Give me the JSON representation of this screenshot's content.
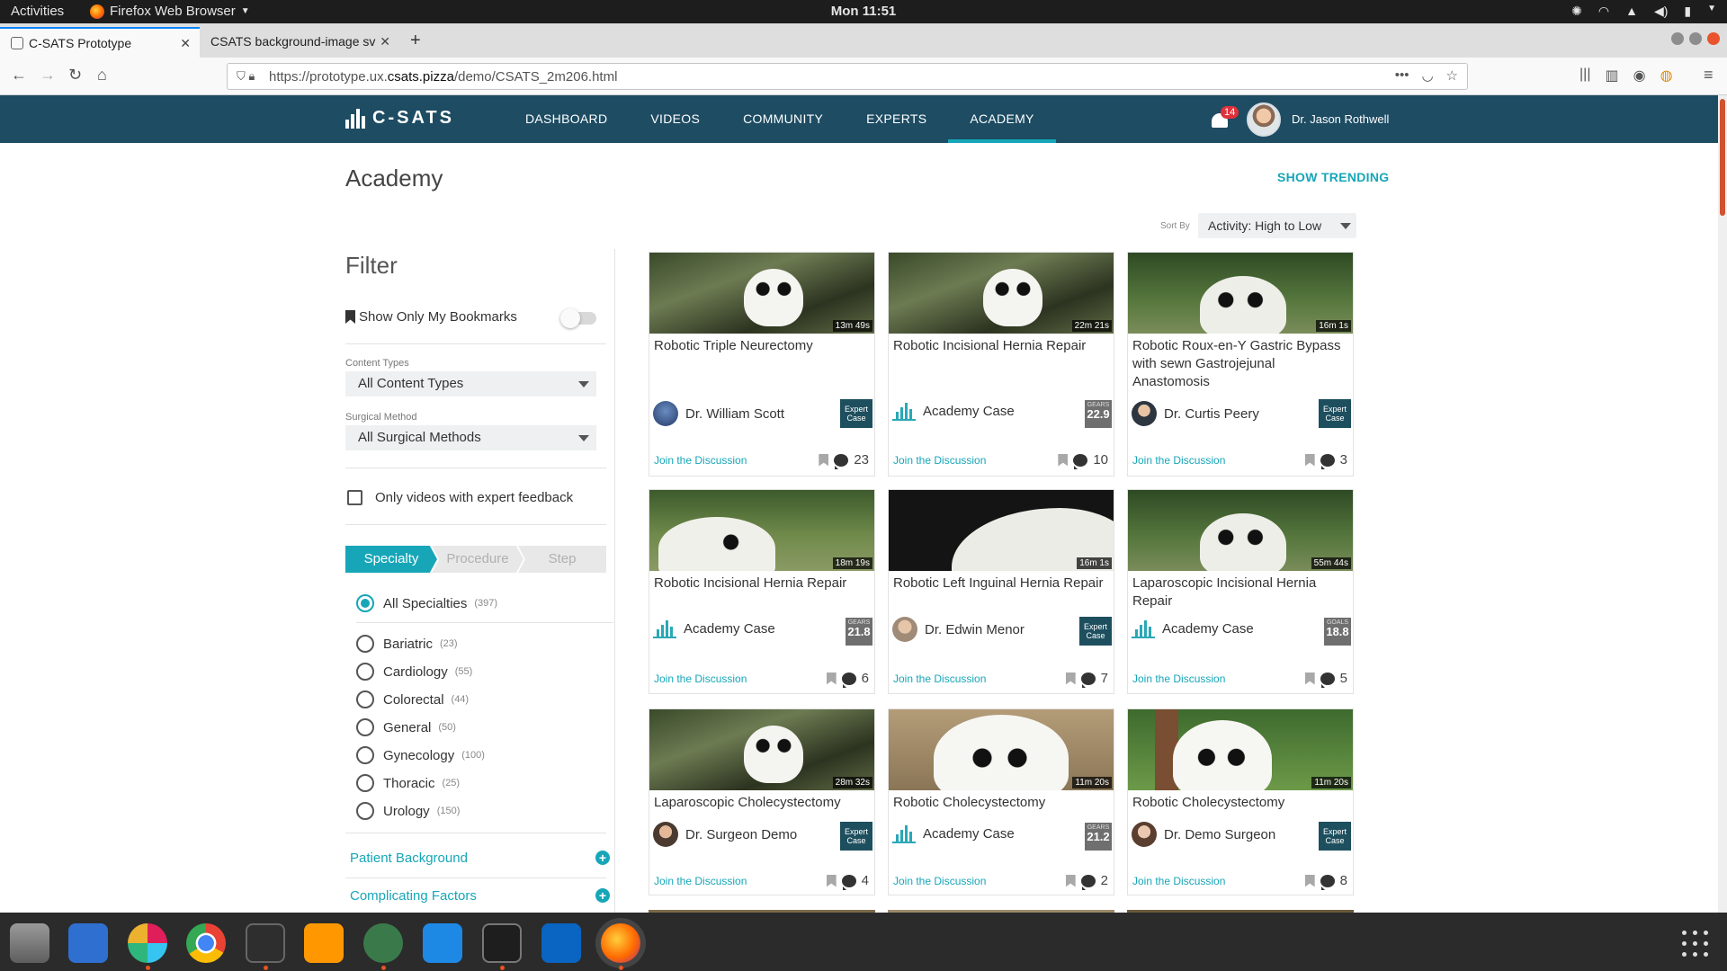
{
  "system": {
    "activities": "Activities",
    "app_name": "Firefox Web Browser",
    "clock": "Mon 11:51"
  },
  "browser": {
    "tabs": [
      {
        "label": "C-SATS Prototype",
        "active": true
      },
      {
        "label": "CSATS background-image sv",
        "active": false
      }
    ],
    "url_prefix": "https://prototype.ux.",
    "url_host": "csats.pizza",
    "url_path": "/demo/CSATS_2m206.html"
  },
  "header": {
    "brand": "C-SATS",
    "nav": [
      {
        "label": "DASHBOARD",
        "active": false
      },
      {
        "label": "VIDEOS",
        "active": false
      },
      {
        "label": "COMMUNITY",
        "active": false
      },
      {
        "label": "EXPERTS",
        "active": false
      },
      {
        "label": "ACADEMY",
        "active": true
      }
    ],
    "notification_count": "14",
    "user_name": "Dr. Jason Rothwell"
  },
  "page": {
    "title": "Academy",
    "show_trending": "SHOW TRENDING",
    "sort_label": "Sort By",
    "sort_value": "Activity: High to Low"
  },
  "filter": {
    "title": "Filter",
    "bookmarks_label": "Show Only My Bookmarks",
    "content_types_label": "Content Types",
    "content_types_value": "All Content Types",
    "surgical_method_label": "Surgical Method",
    "surgical_method_value": "All Surgical Methods",
    "expert_feedback_label": "Only videos with expert feedback",
    "steps": [
      "Specialty",
      "Procedure",
      "Step"
    ],
    "specialties": [
      {
        "label": "All Specialties",
        "count": "(397)",
        "selected": true
      },
      {
        "label": "Bariatric",
        "count": "(23)",
        "selected": false
      },
      {
        "label": "Cardiology",
        "count": "(55)",
        "selected": false
      },
      {
        "label": "Colorectal",
        "count": "(44)",
        "selected": false
      },
      {
        "label": "General",
        "count": "(50)",
        "selected": false
      },
      {
        "label": "Gynecology",
        "count": "(100)",
        "selected": false
      },
      {
        "label": "Thoracic",
        "count": "(25)",
        "selected": false
      },
      {
        "label": "Urology",
        "count": "(150)",
        "selected": false
      }
    ],
    "patient_background": "Patient Background",
    "complicating_factors": "Complicating Factors"
  },
  "cards": [
    {
      "title": "Robotic Triple Neurectomy",
      "duration": "13m 49s",
      "author": "Dr. William Scott",
      "kind": "expert",
      "tag": "Expert Case",
      "join": "Join the Discussion",
      "comments": "23"
    },
    {
      "title": "Robotic Incisional Hernia Repair",
      "duration": "22m 21s",
      "author": "Academy Case",
      "kind": "academy",
      "score_label": "GEARS",
      "score": "22.9",
      "join": "Join the Discussion",
      "comments": "10"
    },
    {
      "title": "Robotic Roux-en-Y Gastric Bypass with sewn Gastrojejunal Anastomosis",
      "duration": "16m 1s",
      "author": "Dr. Curtis Peery",
      "kind": "expert",
      "tag": "Expert Case",
      "join": "Join the Discussion",
      "comments": "3"
    },
    {
      "title": "Robotic Incisional Hernia Repair",
      "duration": "18m 19s",
      "author": "Academy Case",
      "kind": "academy",
      "score_label": "GEARS",
      "score": "21.8",
      "join": "Join the Discussion",
      "comments": "6"
    },
    {
      "title": "Robotic Left Inguinal Hernia Repair",
      "duration": "16m 1s",
      "author": "Dr. Edwin Menor",
      "kind": "expert",
      "tag": "Expert Case",
      "join": "Join the Discussion",
      "comments": "7"
    },
    {
      "title": "Laparoscopic Incisional Hernia Repair",
      "duration": "55m 44s",
      "author": "Academy Case",
      "kind": "academy",
      "score_label": "GOALS",
      "score": "18.8",
      "join": "Join the Discussion",
      "comments": "5"
    },
    {
      "title": "Laparoscopic Cholecystectomy",
      "duration": "28m 32s",
      "author": "Dr. Surgeon Demo",
      "kind": "expert",
      "tag": "Expert Case",
      "join": "Join the Discussion",
      "comments": "4"
    },
    {
      "title": "Robotic Cholecystectomy",
      "duration": "11m 20s",
      "author": "Academy Case",
      "kind": "academy",
      "score_label": "GEARS",
      "score": "21.2",
      "join": "Join the Discussion",
      "comments": "2"
    },
    {
      "title": "Robotic Cholecystectomy",
      "duration": "11m 20s",
      "author": "Dr. Demo Surgeon",
      "kind": "expert",
      "tag": "Expert Case",
      "join": "Join the Discussion",
      "comments": "8"
    }
  ],
  "colors": {
    "header_bg": "#1d4c63",
    "accent": "#17a6b8",
    "expert_tag": "#1e4f5e",
    "score_badge": "#6f6f6f"
  }
}
